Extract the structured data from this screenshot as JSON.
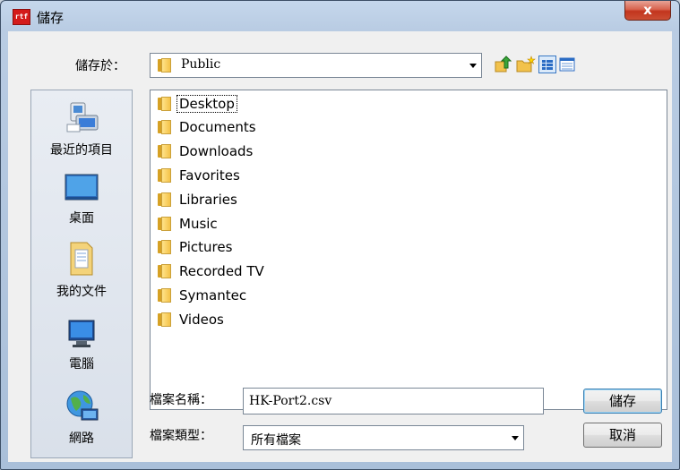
{
  "window": {
    "title": "儲存",
    "app_icon_text": "rtf",
    "close_label": "x"
  },
  "save_in": {
    "label": "儲存於：",
    "value": "Public",
    "toolbar": [
      "up-folder-icon",
      "new-folder-icon",
      "view-list-icon",
      "view-details-icon"
    ]
  },
  "places": [
    {
      "label": "最近的項目",
      "icon": "recent-items-icon"
    },
    {
      "label": "桌面",
      "icon": "desktop-icon"
    },
    {
      "label": "我的文件",
      "icon": "my-documents-icon"
    },
    {
      "label": "電腦",
      "icon": "computer-icon"
    },
    {
      "label": "網路",
      "icon": "network-icon"
    }
  ],
  "files": [
    {
      "name": "Desktop"
    },
    {
      "name": "Documents"
    },
    {
      "name": "Downloads"
    },
    {
      "name": "Favorites"
    },
    {
      "name": "Libraries"
    },
    {
      "name": "Music"
    },
    {
      "name": "Pictures"
    },
    {
      "name": "Recorded TV"
    },
    {
      "name": "Symantec"
    },
    {
      "name": "Videos"
    }
  ],
  "filename": {
    "label": "檔案名稱：",
    "value": "HK-Port2.csv"
  },
  "filetype": {
    "label": "檔案類型：",
    "value": "所有檔案"
  },
  "buttons": {
    "save": "儲存",
    "cancel": "取消"
  },
  "colors": {
    "close_button": "#c9442b",
    "title_gradient_top": "#c5d7ec",
    "client_bg": "#f0f0f0"
  }
}
